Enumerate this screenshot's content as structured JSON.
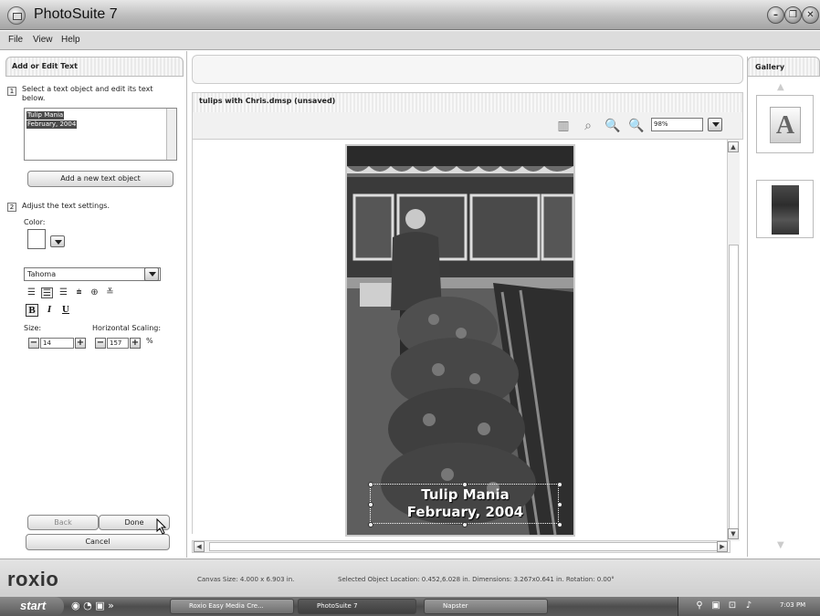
{
  "app": {
    "title": "PhotoSuite 7"
  },
  "menu": [
    "File",
    "View",
    "Help"
  ],
  "left_panel": {
    "header": "Add or Edit Text",
    "step1": {
      "num": "1",
      "text_line1": "Select a text object and edit its text",
      "text_line2": "below."
    },
    "text_value": [
      "Tulip Mania",
      "February, 2004"
    ],
    "add_button": "Add a new text object",
    "step2": {
      "num": "2",
      "text": "Adjust the text settings."
    },
    "color_label": "Color:",
    "color_value": "#ffffff",
    "font": "Tahoma",
    "size_label": "Size:",
    "size_value": "14",
    "hscale_label": "Horizontal Scaling:",
    "hscale_value": "157",
    "hscale_unit": "%",
    "back_button": "Back",
    "done_button": "Done",
    "cancel_button": "Cancel"
  },
  "document": {
    "title": "tulips with Chris.dmsp (unsaved)",
    "zoom": "98%"
  },
  "overlay": {
    "line1": "Tulip Mania",
    "line2": "February, 2004"
  },
  "gallery": {
    "header": "Gallery",
    "thumb1_letter": "A"
  },
  "status": {
    "logo": "roxio",
    "canvas_size": "Canvas Size: 4.000 x 6.903 in.",
    "selected": "Selected Object Location: 0.452,6.028 in. Dimensions: 3.267x0.641 in. Rotation: 0.00°"
  },
  "taskbar": {
    "start": "start",
    "tasks": [
      "Roxio Easy Media Cre...",
      "PhotoSuite 7",
      "Napster"
    ],
    "clock": "7:03 PM"
  }
}
